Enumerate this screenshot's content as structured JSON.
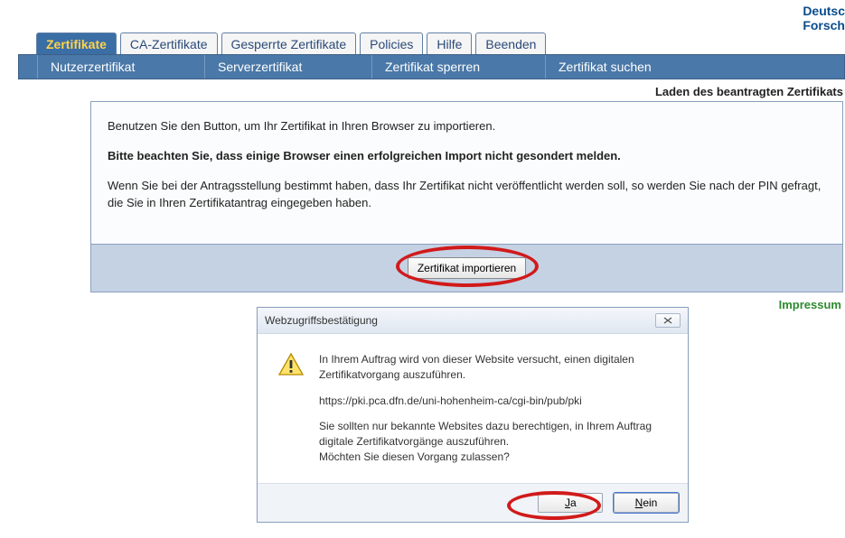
{
  "logo": {
    "line1": "Deutsc",
    "line2": "Forsch"
  },
  "tabs": [
    {
      "label": "Zertifikate",
      "active": true
    },
    {
      "label": "CA-Zertifikate"
    },
    {
      "label": "Gesperrte Zertifikate"
    },
    {
      "label": "Policies"
    },
    {
      "label": "Hilfe"
    },
    {
      "label": "Beenden"
    }
  ],
  "subnav": [
    {
      "label": "Nutzerzertifikat"
    },
    {
      "label": "Serverzertifikat"
    },
    {
      "label": "Zertifikat sperren"
    },
    {
      "label": "Zertifikat suchen"
    }
  ],
  "section_title": "Laden des beantragten Zertifikats",
  "content": {
    "p1": "Benutzen Sie den Button, um Ihr Zertifikat in Ihren Browser zu importieren.",
    "p2": "Bitte beachten Sie, dass einige Browser einen erfolgreichen Import nicht gesondert melden.",
    "p3": "Wenn Sie bei der Antragsstellung bestimmt haben, dass Ihr Zertifikat nicht veröffentlicht werden soll, so werden Sie nach der PIN gefragt, die Sie in Ihren Zertifikatantrag eingegeben haben.",
    "import_button": "Zertifikat importieren"
  },
  "impressum": "Impressum",
  "dialog": {
    "title": "Webzugriffsbestätigung",
    "p1": "In Ihrem Auftrag wird von dieser Website versucht, einen digitalen Zertifikatvorgang auszuführen.",
    "url": "https://pki.pca.dfn.de/uni-hohenheim-ca/cgi-bin/pub/pki",
    "p2": "Sie sollten nur bekannte Websites dazu berechtigen, in Ihrem Auftrag digitale Zertifikatvorgänge auszuführen.",
    "p3": "Möchten Sie diesen Vorgang zulassen?",
    "yes_underline": "J",
    "yes_rest": "a",
    "no_underline": "N",
    "no_rest": "ein"
  }
}
